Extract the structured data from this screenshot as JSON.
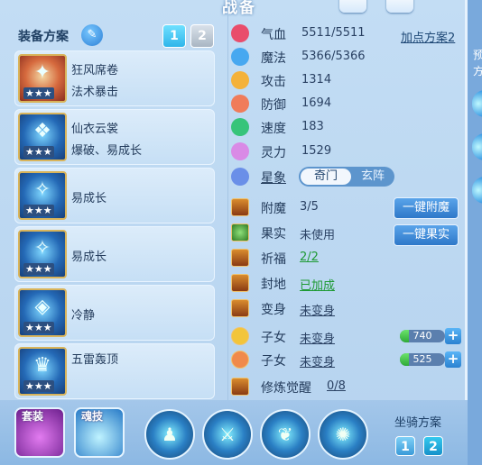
{
  "title": "战备",
  "equipment": {
    "header_label": "装备方案",
    "plan_tabs": [
      "1",
      "2"
    ],
    "items": [
      {
        "line1": "狂风席卷",
        "line2": "法术暴击",
        "stars": "★★★"
      },
      {
        "line1": "仙衣云裳",
        "line2": "爆破、易成长",
        "stars": "★★★"
      },
      {
        "line1": "易成长",
        "stars": "★★★"
      },
      {
        "line1": "易成长",
        "stars": "★★★"
      },
      {
        "line1": "冷静",
        "stars": "★★★"
      },
      {
        "line1": "五雷轰顶",
        "stars": "★★★"
      }
    ]
  },
  "attributes": {
    "plan_link": "加点方案2",
    "stats": [
      {
        "name": "气血",
        "value": "5511/5511"
      },
      {
        "name": "魔法",
        "value": "5366/5366"
      },
      {
        "name": "攻击",
        "value": "1314"
      },
      {
        "name": "防御",
        "value": "1694"
      },
      {
        "name": "速度",
        "value": "183"
      },
      {
        "name": "灵力",
        "value": "1529"
      }
    ],
    "star_label": "星象",
    "star_tabs": [
      "奇门",
      "玄阵"
    ]
  },
  "extras": [
    {
      "name": "附魔",
      "value": "3/5"
    },
    {
      "name": "果实",
      "value": "未使用"
    },
    {
      "name": "祈福",
      "value": "2/2"
    },
    {
      "name": "封地",
      "value": "已加成"
    },
    {
      "name": "变身",
      "value": "未变身"
    },
    {
      "name": "子女",
      "value": "未变身"
    },
    {
      "name": "子女",
      "value": "未变身"
    },
    {
      "name": "修炼觉醒",
      "value": "0/8"
    }
  ],
  "buttons": {
    "enchant": "一键附魔",
    "fruit": "一键果实"
  },
  "child_bars": [
    {
      "value": "740",
      "fill": 0.2
    },
    {
      "value": "525",
      "fill": 0.2
    }
  ],
  "bottom": {
    "suit_label": "套装",
    "soul_label": "魂技",
    "mount_label": "坐骑方案",
    "mount_tabs": [
      "1",
      "2"
    ]
  },
  "side_text": [
    "预",
    "方"
  ],
  "colors": {
    "accent": "#2fb5ea",
    "panel": "#c3ddf4",
    "good": "#1e9a34"
  }
}
